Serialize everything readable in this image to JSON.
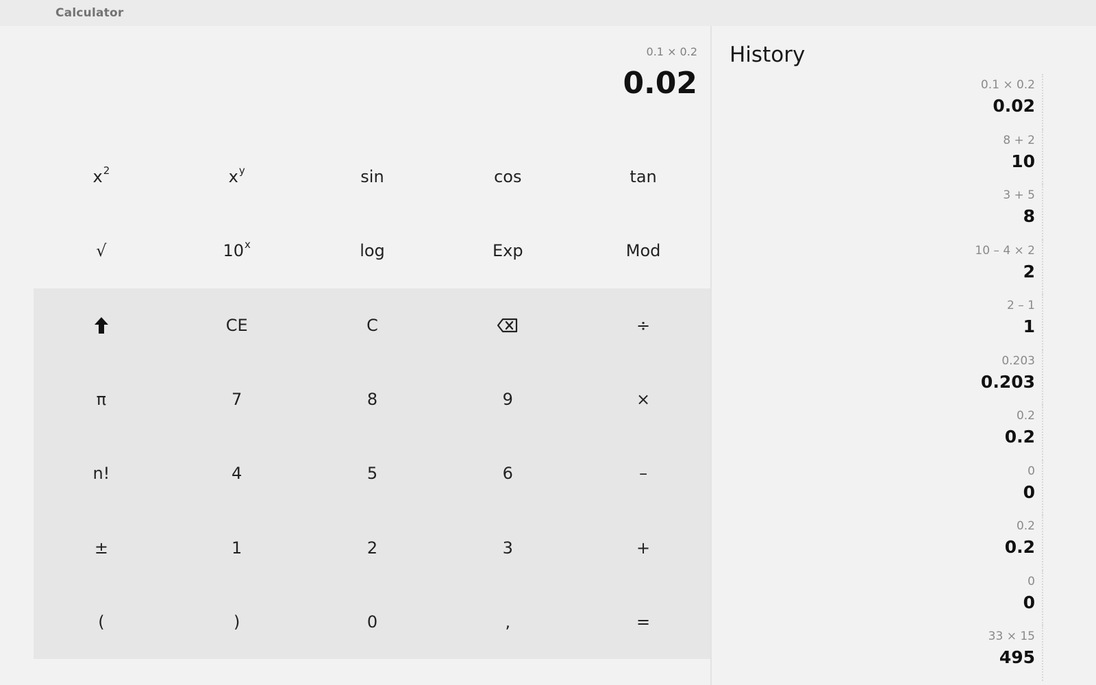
{
  "window": {
    "title": "Calculator"
  },
  "display": {
    "expression": "0.1 × 0.2",
    "result": "0.02"
  },
  "keys": {
    "r1": [
      {
        "name": "square-button",
        "base": "x",
        "sup": "2"
      },
      {
        "name": "power-button",
        "base": "x",
        "sup": "y"
      },
      {
        "name": "sin-button",
        "label": "sin"
      },
      {
        "name": "cos-button",
        "label": "cos"
      },
      {
        "name": "tan-button",
        "label": "tan"
      }
    ],
    "r2": [
      {
        "name": "sqrt-button",
        "label": "√"
      },
      {
        "name": "ten-power-button",
        "base": "10",
        "sup": "x"
      },
      {
        "name": "log-button",
        "label": "log"
      },
      {
        "name": "exp-button",
        "label": "Exp"
      },
      {
        "name": "mod-button",
        "label": "Mod"
      }
    ],
    "ce": "CE",
    "c": "C",
    "divide": "÷",
    "pi": "π",
    "seven": "7",
    "eight": "8",
    "nine": "9",
    "multiply": "×",
    "factorial": "n!",
    "four": "4",
    "five": "5",
    "six": "6",
    "minus": "–",
    "plusminus": "±",
    "one": "1",
    "two": "2",
    "three": "3",
    "plus": "+",
    "lparen": "(",
    "rparen": ")",
    "zero": "0",
    "comma": ",",
    "equals": "="
  },
  "history": {
    "title": "History",
    "items": [
      {
        "expr": "0.1 × 0.2",
        "result": "0.02"
      },
      {
        "expr": "8 + 2",
        "result": "10"
      },
      {
        "expr": "3 + 5",
        "result": "8"
      },
      {
        "expr": "10 – 4 × 2",
        "result": "2"
      },
      {
        "expr": "2 – 1",
        "result": "1"
      },
      {
        "expr": "0.203",
        "result": "0.203"
      },
      {
        "expr": "0.2",
        "result": "0.2"
      },
      {
        "expr": "0",
        "result": "0"
      },
      {
        "expr": "0.2",
        "result": "0.2"
      },
      {
        "expr": "0",
        "result": "0"
      },
      {
        "expr": "33 × 15",
        "result": "495"
      }
    ]
  }
}
